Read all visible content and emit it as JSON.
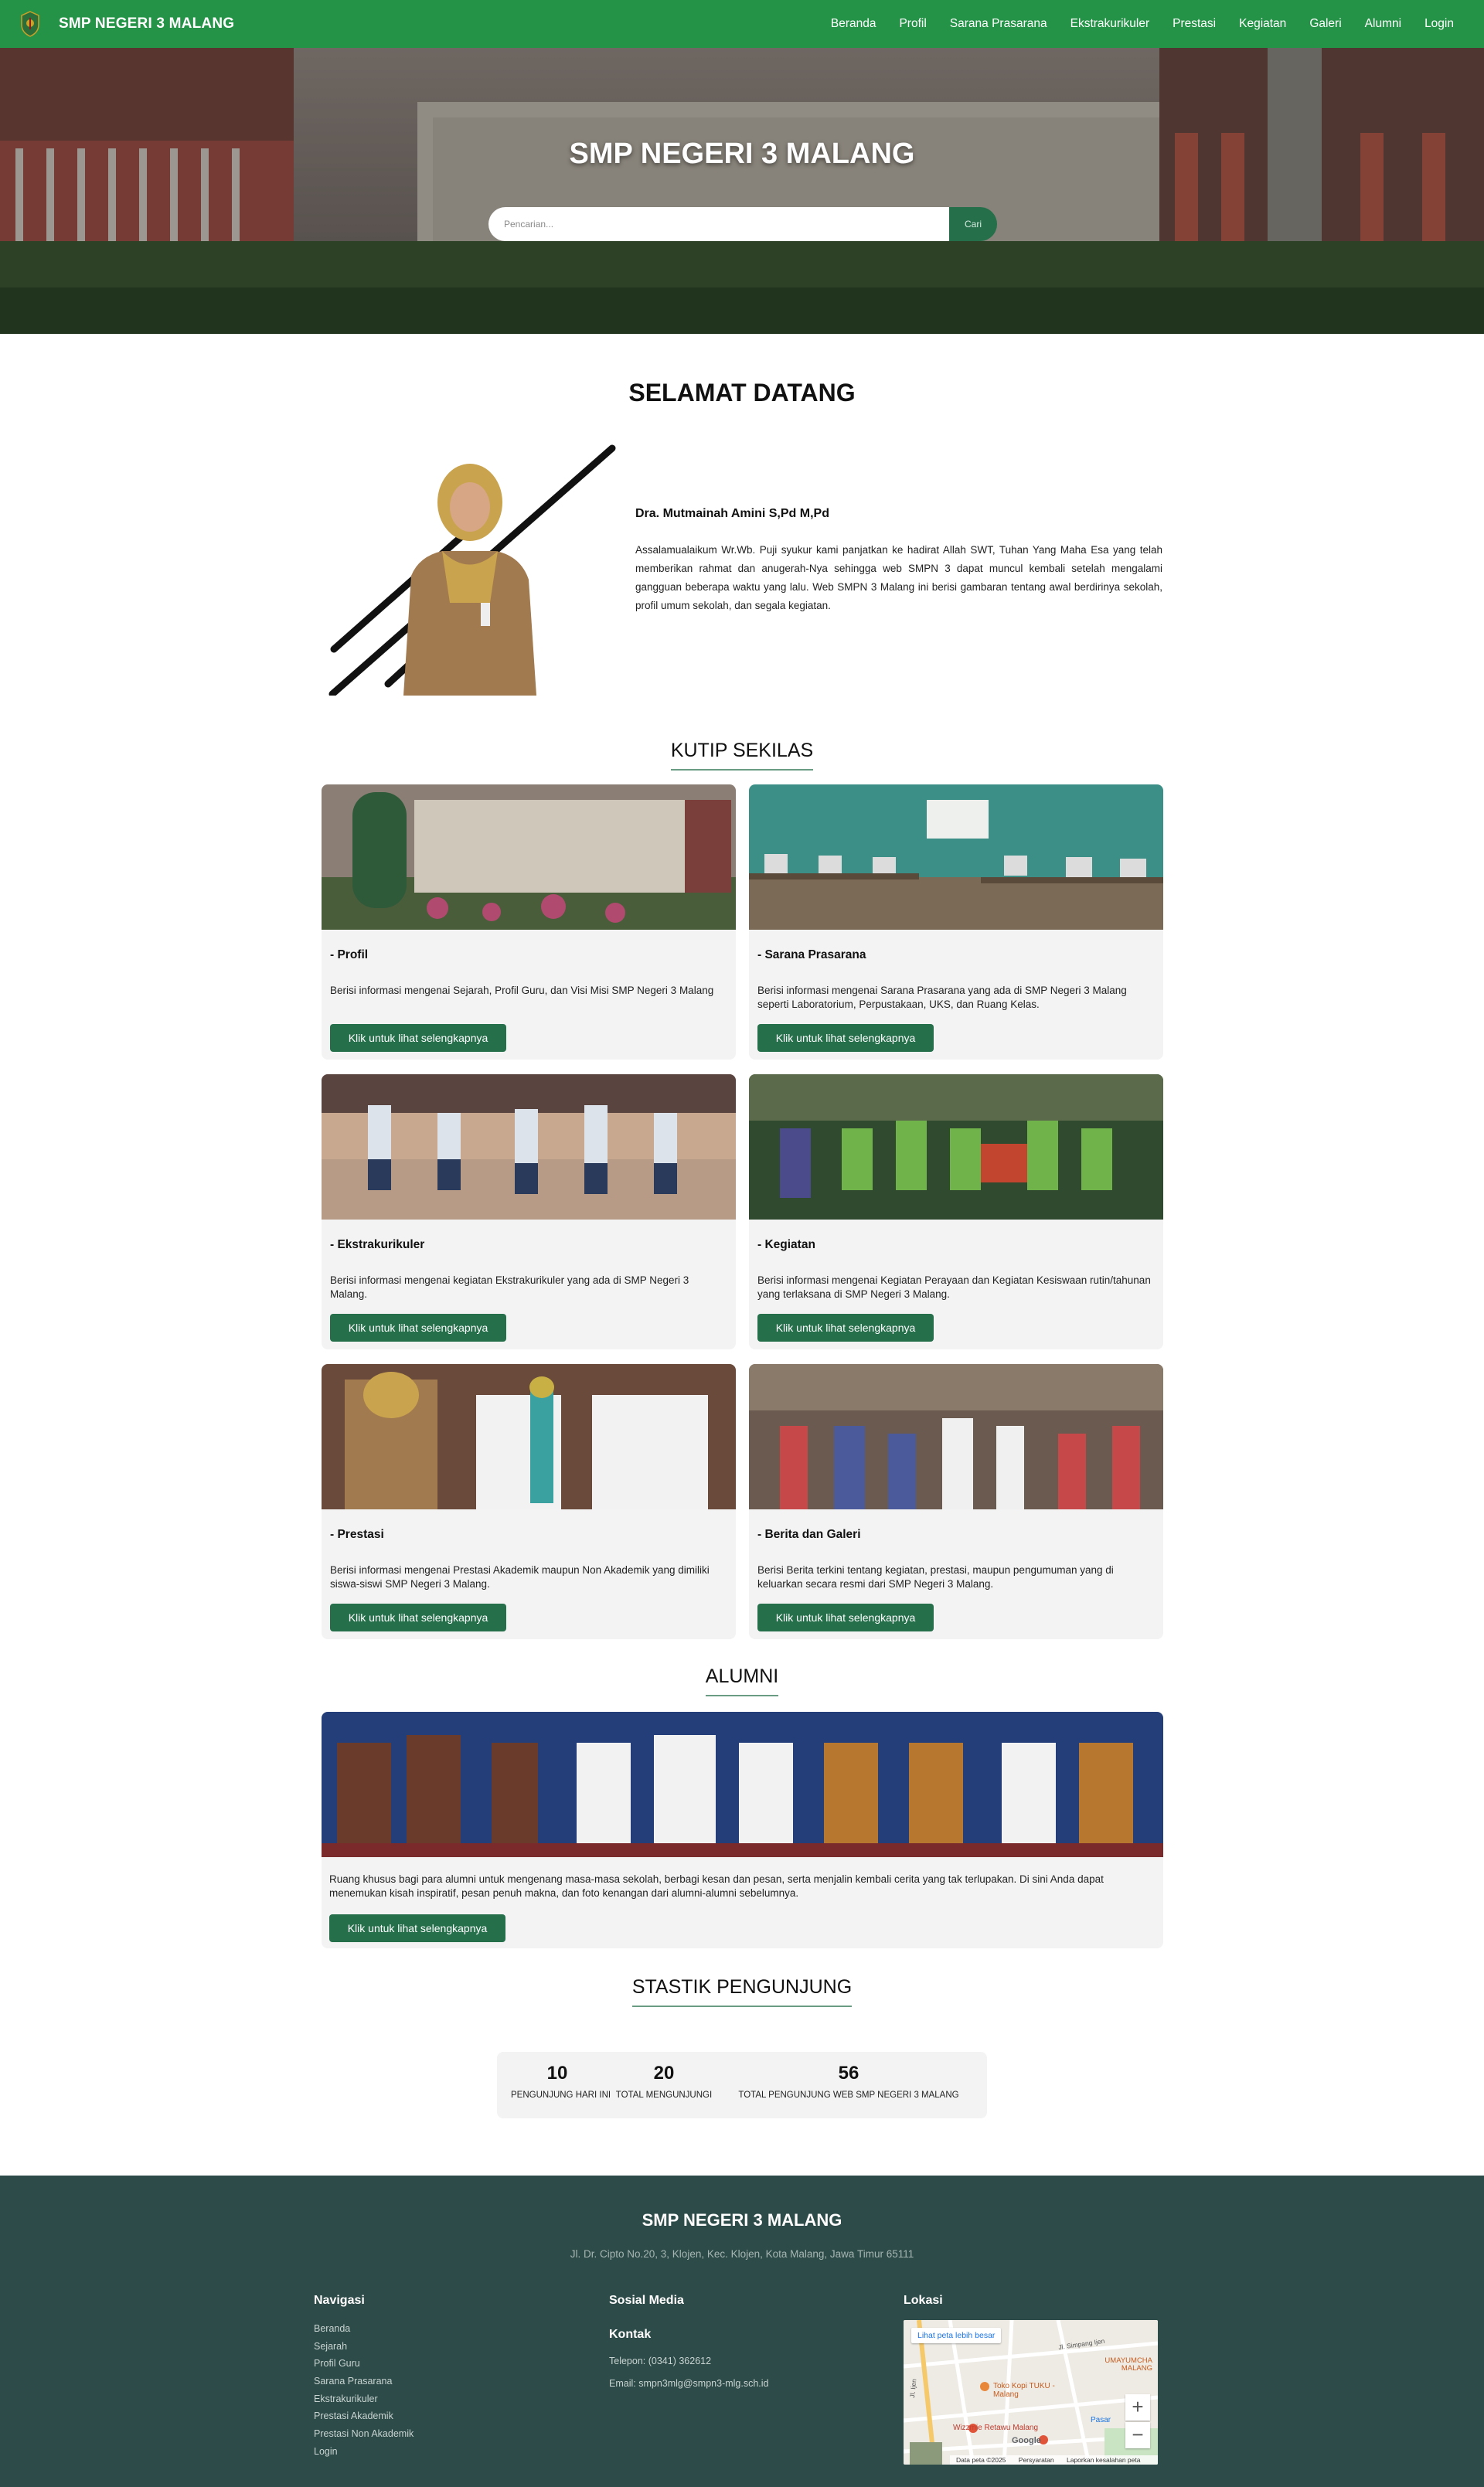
{
  "navbar": {
    "brand": "SMP NEGERI 3 MALANG",
    "items": [
      "Beranda",
      "Profil",
      "Sarana Prasarana",
      "Ekstrakurikuler",
      "Prestasi",
      "Kegiatan",
      "Galeri",
      "Alumni",
      "Login"
    ]
  },
  "hero": {
    "title": "SMP NEGERI 3 MALANG",
    "search_placeholder": "Pencarian...",
    "search_button": "Cari"
  },
  "welcome": {
    "title": "SELAMAT DATANG",
    "name": "Dra. Mutmainah Amini S,Pd M,Pd",
    "text": "Assalamualaikum Wr.Wb. Puji syukur kami panjatkan ke hadirat Allah SWT, Tuhan Yang Maha Esa yang telah memberikan rahmat dan anugerah-Nya sehingga web SMPN 3 dapat muncul kembali setelah mengalami gangguan beberapa waktu yang lalu. Web SMPN 3 Malang ini berisi gambaran tentang awal berdirinya sekolah, profil umum sekolah, dan segala kegiatan."
  },
  "kutip": {
    "title": "KUTIP SEKILAS",
    "cards": [
      {
        "title": "- Profil",
        "desc": "Berisi informasi mengenai Sejarah, Profil Guru, dan Visi Misi SMP Negeri 3 Malang",
        "button": "Klik untuk lihat selengkapnya"
      },
      {
        "title": "- Sarana Prasarana",
        "desc": "Berisi informasi mengenai Sarana Prasarana yang ada di SMP Negeri 3 Malang seperti Laboratorium, Perpustakaan, UKS, dan Ruang Kelas.",
        "button": "Klik untuk lihat selengkapnya"
      },
      {
        "title": "- Ekstrakurikuler",
        "desc": "Berisi informasi mengenai kegiatan Ekstrakurikuler yang ada di SMP Negeri 3 Malang.",
        "button": "Klik untuk lihat selengkapnya"
      },
      {
        "title": "- Kegiatan",
        "desc": "Berisi informasi mengenai Kegiatan Perayaan dan Kegiatan Kesiswaan rutin/tahunan yang terlaksana di SMP Negeri 3 Malang.",
        "button": "Klik untuk lihat selengkapnya"
      },
      {
        "title": "- Prestasi",
        "desc": "Berisi informasi mengenai Prestasi Akademik maupun Non Akademik yang dimiliki siswa-siswi SMP Negeri 3 Malang.",
        "button": "Klik untuk lihat selengkapnya"
      },
      {
        "title": "- Berita dan Galeri",
        "desc": "Berisi Berita terkini tentang kegiatan, prestasi, maupun pengumuman yang di keluarkan secara resmi dari SMP Negeri 3 Malang.",
        "button": "Klik untuk lihat selengkapnya"
      }
    ]
  },
  "alumni": {
    "title": "ALUMNI",
    "text": "Ruang khusus bagi para alumni untuk mengenang masa-masa sekolah, berbagi kesan dan pesan, serta menjalin kembali cerita yang tak terlupakan. Di sini Anda dapat menemukan kisah inspiratif, pesan penuh makna, dan foto kenangan dari alumni-alumni sebelumnya.",
    "button": "Klik untuk lihat selengkapnya"
  },
  "stats": {
    "title": "STASTIK PENGUNJUNG",
    "items": [
      {
        "value": "10",
        "label": "PENGUNJUNG HARI INI"
      },
      {
        "value": "20",
        "label": "TOTAL MENGUNJUNGI"
      },
      {
        "value": "56",
        "label": "TOTAL PENGUNJUNG WEB SMP NEGERI 3 MALANG"
      }
    ]
  },
  "footer": {
    "title": "SMP NEGERI 3 MALANG",
    "address": "Jl. Dr. Cipto No.20, 3, Klojen, Kec. Klojen, Kota Malang, Jawa Timur 65111",
    "nav_title": "Navigasi",
    "nav_items": [
      "Beranda",
      "Sejarah",
      "Profil Guru",
      "Sarana Prasarana",
      "Ekstrakurikuler",
      "Prestasi Akademik",
      "Prestasi Non Akademik",
      "Login"
    ],
    "social_title": "Sosial Media",
    "contact_title": "Kontak",
    "phone": "Telepon: (0341) 362612",
    "email": "Email: smpn3mlg@smpn3-mlg.sch.id",
    "location_title": "Lokasi",
    "map": {
      "larger": "Lihat peta lebih besar",
      "zoom_in": "+",
      "zoom_out": "−",
      "labels": [
        "Toko Kopi TUKU - Malang",
        "Wizzmie Retawu Malang",
        "UMAYUMCHA MALANG",
        "Pasar",
        "Jl. Simpang Ijen",
        "Jl. Ijen",
        "Google"
      ],
      "attribution": [
        "Data peta ©2025",
        "Persyaratan",
        "Laporkan kesalahan peta"
      ]
    }
  },
  "colors": {
    "navbar": "#259347",
    "button": "#256f4b",
    "footer": "#2d4b48",
    "card_bg": "#f3f3f3"
  }
}
